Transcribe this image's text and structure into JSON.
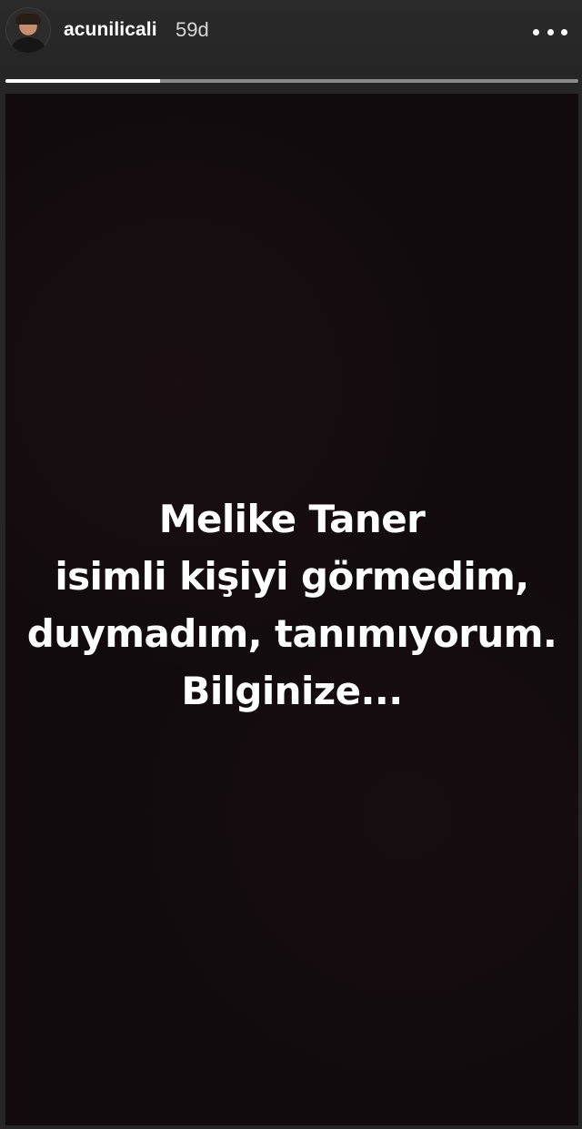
{
  "header": {
    "avatar_icon": "profile-avatar-icon",
    "username": "acunilicali",
    "age": "59d",
    "more_icon": "more-options-icon"
  },
  "progress": {
    "fraction": 0.27
  },
  "story": {
    "lines": [
      "Melike Taner",
      "isimli kişiyi görmedim,",
      "duymadım, tanımıyorum.",
      "Bilginize..."
    ]
  },
  "colors": {
    "background": "#262626",
    "story_background": "#120b0d",
    "text": "#ffffff",
    "progress_track": "#8c8c8c",
    "progress_fill": "#ffffff"
  }
}
